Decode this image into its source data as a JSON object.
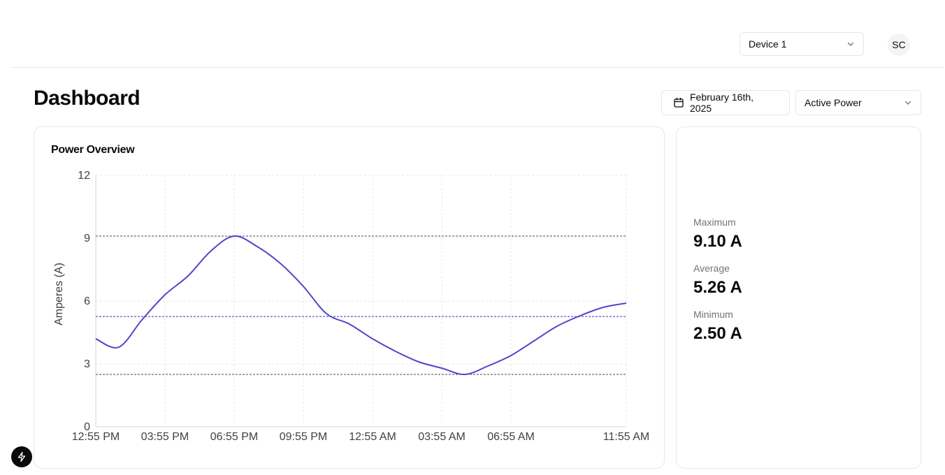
{
  "header": {
    "device_select": {
      "value": "Device 1",
      "icon": "chevron-down-icon"
    },
    "avatar": {
      "initials": "SC"
    }
  },
  "page": {
    "title": "Dashboard"
  },
  "toolbar": {
    "date_picker": {
      "value": "February 16th, 2025",
      "icon": "calendar-icon"
    },
    "metric_select": {
      "value": "Active Power",
      "icon": "chevron-down-icon"
    }
  },
  "chart_card": {
    "title": "Power Overview"
  },
  "chart_data": {
    "type": "line",
    "title": "Power Overview",
    "xlabel": "",
    "ylabel": "Amperes (A)",
    "ylim": [
      0,
      12
    ],
    "yticks": [
      0,
      3,
      6,
      9,
      12
    ],
    "x_tick_labels": [
      "12:55 PM",
      "03:55 PM",
      "06:55 PM",
      "09:55 PM",
      "12:55 AM",
      "03:55 AM",
      "06:55 AM",
      "11:55 AM"
    ],
    "x_tick_hours": [
      0,
      3,
      6,
      9,
      12,
      15,
      18,
      23
    ],
    "x_range_hours": [
      0,
      23
    ],
    "grid": true,
    "series": [
      {
        "color": "#5046c8",
        "points": [
          [
            0,
            4.2
          ],
          [
            1,
            3.8
          ],
          [
            2,
            5.1
          ],
          [
            3,
            6.3
          ],
          [
            4,
            7.2
          ],
          [
            5,
            8.4
          ],
          [
            6,
            9.1
          ],
          [
            7,
            8.6
          ],
          [
            8,
            7.8
          ],
          [
            9,
            6.7
          ],
          [
            10,
            5.4
          ],
          [
            11,
            4.9
          ],
          [
            12,
            4.2
          ],
          [
            13,
            3.6
          ],
          [
            14,
            3.1
          ],
          [
            15,
            2.8
          ],
          [
            16,
            2.5
          ],
          [
            17,
            2.9
          ],
          [
            18,
            3.4
          ],
          [
            19,
            4.1
          ],
          [
            20,
            4.8
          ],
          [
            21,
            5.3
          ],
          [
            22,
            5.7
          ],
          [
            23,
            5.9
          ]
        ]
      }
    ],
    "reference_lines": [
      {
        "name": "Maximum",
        "value": 9.1,
        "color": "#6b6b6b"
      },
      {
        "name": "Average",
        "value": 5.26,
        "color": "#6e67d6"
      },
      {
        "name": "Minimum",
        "value": 2.5,
        "color": "#6b6b6b"
      }
    ]
  },
  "stats": {
    "maximum_label": "Maximum",
    "maximum_value": "9.10 A",
    "average_label": "Average",
    "average_value": "5.26 A",
    "minimum_label": "Minimum",
    "minimum_value": "2.50 A"
  },
  "floating": {
    "icon": "bolt-icon"
  }
}
